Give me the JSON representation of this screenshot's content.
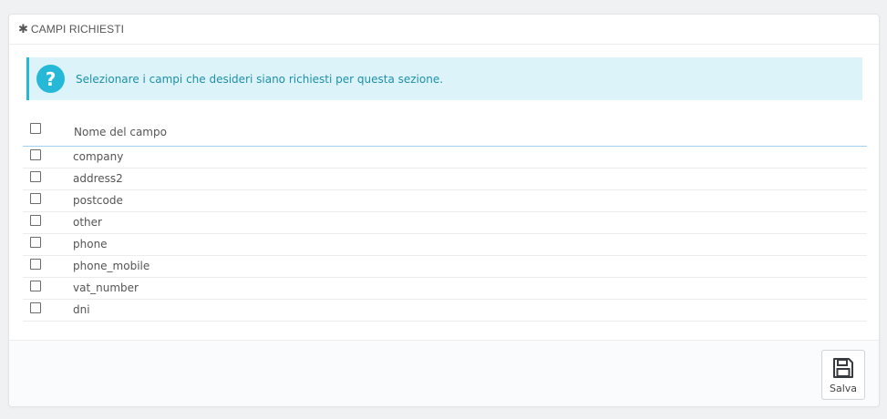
{
  "panel": {
    "title": "CAMPI RICHIESTI",
    "icon": "asterisk-icon"
  },
  "alert": {
    "icon": "question-circle-icon",
    "text": "Selezionare i campi che desideri siano richiesti per questa sezione.",
    "color": "#25b9d7"
  },
  "table": {
    "header": "Nome del campo",
    "rows": [
      {
        "name": "company"
      },
      {
        "name": "address2"
      },
      {
        "name": "postcode"
      },
      {
        "name": "other"
      },
      {
        "name": "phone"
      },
      {
        "name": "phone_mobile"
      },
      {
        "name": "vat_number"
      },
      {
        "name": "dni"
      }
    ]
  },
  "footer": {
    "save_label": "Salva",
    "save_icon": "floppy-disk-icon"
  }
}
